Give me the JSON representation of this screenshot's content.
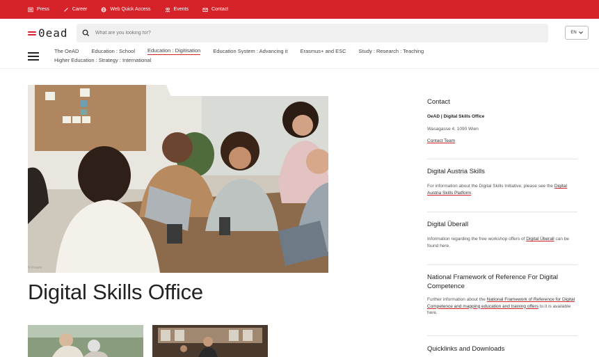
{
  "topbar": {
    "items": [
      {
        "label": "Press",
        "icon": "newspaper-icon"
      },
      {
        "label": "Career",
        "icon": "career-icon"
      },
      {
        "label": "Web Quick Access",
        "icon": "globe-icon"
      },
      {
        "label": "Events",
        "icon": "people-icon"
      },
      {
        "label": "Contact",
        "icon": "mail-icon"
      }
    ],
    "color": "#d6232a"
  },
  "logo": {
    "text": "0ead"
  },
  "search": {
    "placeholder": "What are you looking for?"
  },
  "language": {
    "selected": "EN"
  },
  "nav": {
    "row1": [
      "The OeAD",
      "Education : School",
      "Education : Digitisation",
      "Education System : Advancing it",
      "Erasmus+ and ESC",
      "Study : Research : Teaching"
    ],
    "row2": [
      "Higher Education : Strategy : International"
    ],
    "active": "Education : Digitisation"
  },
  "hero": {
    "credit": "© Pexels"
  },
  "page_title": "Digital Skills Office",
  "sidebar": {
    "contact": {
      "title": "Contact",
      "org": "OeAD | Digital Skills Office",
      "address": "Wasagasse 4, 1090 Wien",
      "link": "Contact Team"
    },
    "austria": {
      "title": "Digital Austria Skills",
      "text": "For information about the Digital Skills Initiative, please see the",
      "link": "Digital Austria Skills Platform",
      "end": "."
    },
    "ueberall": {
      "title": "Digital Überall",
      "text": "Information regarding the free workshop offers of",
      "link": "Digital Überall",
      "end": "can be found here."
    },
    "framework": {
      "title": "National Framework of Reference For Digital Competence",
      "text": "Further information about the",
      "link": "National Framework of Reference for Digital Competence and mapping education and training offers",
      "end": "to it is available here."
    },
    "quicklinks": {
      "title": "Quicklinks and Downloads"
    }
  },
  "accent": "#d6232a"
}
